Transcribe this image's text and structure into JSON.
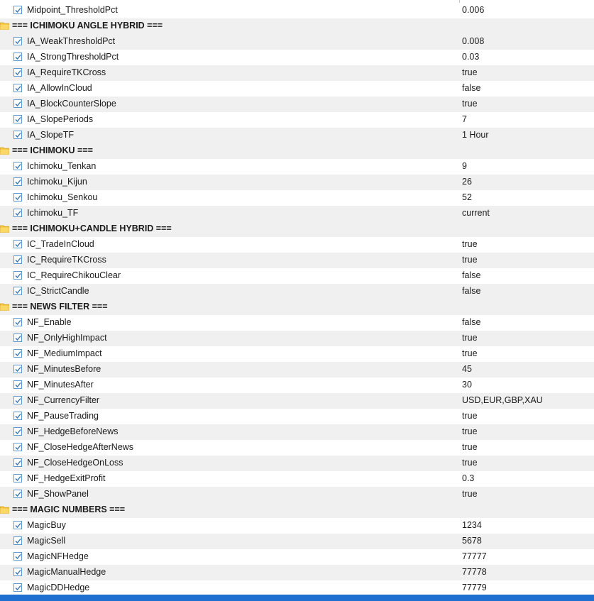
{
  "colors": {
    "accent": "#1f6fd0",
    "checkbox": "#5a9bd5",
    "folder": "#f5c542"
  },
  "rows": [
    {
      "type": "param",
      "name": "Midpoint_ThresholdPct",
      "value": "0.006"
    },
    {
      "type": "group",
      "title": "=== ICHIMOKU ANGLE HYBRID ==="
    },
    {
      "type": "param",
      "name": "IA_WeakThresholdPct",
      "value": "0.008"
    },
    {
      "type": "param",
      "name": "IA_StrongThresholdPct",
      "value": "0.03"
    },
    {
      "type": "param",
      "name": "IA_RequireTKCross",
      "value": "true"
    },
    {
      "type": "param",
      "name": "IA_AllowInCloud",
      "value": "false"
    },
    {
      "type": "param",
      "name": "IA_BlockCounterSlope",
      "value": "true"
    },
    {
      "type": "param",
      "name": "IA_SlopePeriods",
      "value": "7"
    },
    {
      "type": "param",
      "name": "IA_SlopeTF",
      "value": "1 Hour"
    },
    {
      "type": "group",
      "title": "=== ICHIMOKU ==="
    },
    {
      "type": "param",
      "name": "Ichimoku_Tenkan",
      "value": "9"
    },
    {
      "type": "param",
      "name": "Ichimoku_Kijun",
      "value": "26"
    },
    {
      "type": "param",
      "name": "Ichimoku_Senkou",
      "value": "52"
    },
    {
      "type": "param",
      "name": "Ichimoku_TF",
      "value": "current"
    },
    {
      "type": "group",
      "title": "=== ICHIMOKU+CANDLE HYBRID ==="
    },
    {
      "type": "param",
      "name": "IC_TradeInCloud",
      "value": "true"
    },
    {
      "type": "param",
      "name": "IC_RequireTKCross",
      "value": "true"
    },
    {
      "type": "param",
      "name": "IC_RequireChikouClear",
      "value": "false"
    },
    {
      "type": "param",
      "name": "IC_StrictCandle",
      "value": "false"
    },
    {
      "type": "group",
      "title": "=== NEWS FILTER ==="
    },
    {
      "type": "param",
      "name": "NF_Enable",
      "value": "false"
    },
    {
      "type": "param",
      "name": "NF_OnlyHighImpact",
      "value": "true"
    },
    {
      "type": "param",
      "name": "NF_MediumImpact",
      "value": "true"
    },
    {
      "type": "param",
      "name": "NF_MinutesBefore",
      "value": "45"
    },
    {
      "type": "param",
      "name": "NF_MinutesAfter",
      "value": "30"
    },
    {
      "type": "param",
      "name": "NF_CurrencyFilter",
      "value": "USD,EUR,GBP,XAU"
    },
    {
      "type": "param",
      "name": "NF_PauseTrading",
      "value": "true"
    },
    {
      "type": "param",
      "name": "NF_HedgeBeforeNews",
      "value": "true"
    },
    {
      "type": "param",
      "name": "NF_CloseHedgeAfterNews",
      "value": "true"
    },
    {
      "type": "param",
      "name": "NF_CloseHedgeOnLoss",
      "value": "true"
    },
    {
      "type": "param",
      "name": "NF_HedgeExitProfit",
      "value": "0.3"
    },
    {
      "type": "param",
      "name": "NF_ShowPanel",
      "value": "true"
    },
    {
      "type": "group",
      "title": "=== MAGIC NUMBERS ==="
    },
    {
      "type": "param",
      "name": "MagicBuy",
      "value": "1234"
    },
    {
      "type": "param",
      "name": "MagicSell",
      "value": "5678"
    },
    {
      "type": "param",
      "name": "MagicNFHedge",
      "value": "77777"
    },
    {
      "type": "param",
      "name": "MagicManualHedge",
      "value": "77778"
    },
    {
      "type": "param",
      "name": "MagicDDHedge",
      "value": "77779"
    }
  ]
}
